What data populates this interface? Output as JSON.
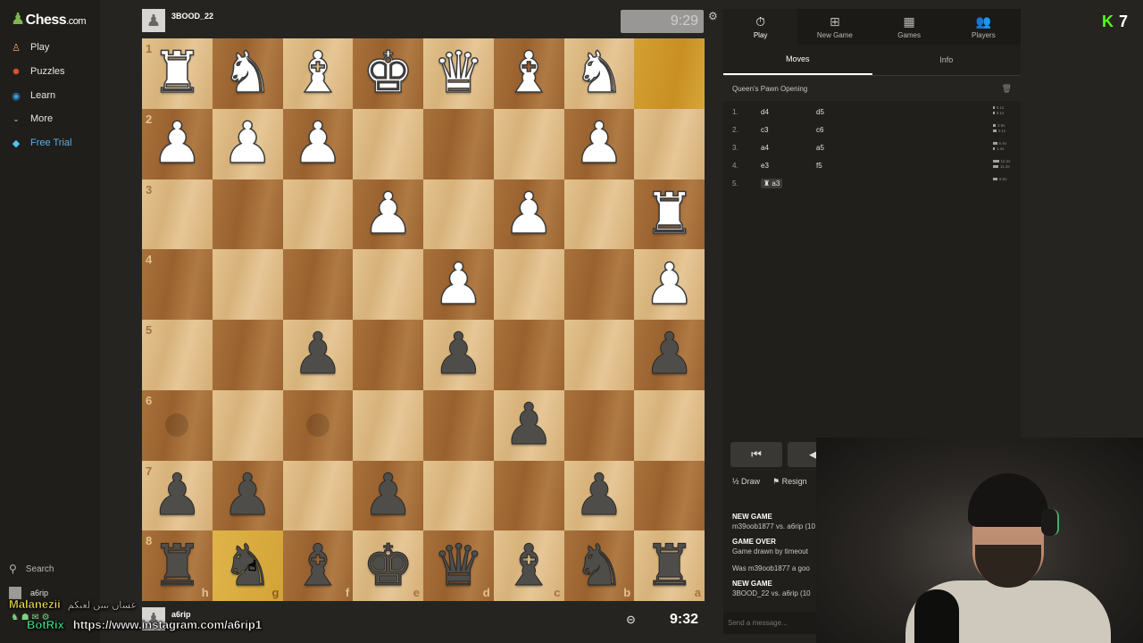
{
  "sidebar": {
    "logo_text": "Chess",
    "logo_suffix": ".com",
    "items": [
      {
        "label": "Play",
        "icon": "play-icon"
      },
      {
        "label": "Puzzles",
        "icon": "puzzle-icon"
      },
      {
        "label": "Learn",
        "icon": "learn-icon"
      },
      {
        "label": "More",
        "icon": "chevron-down-icon"
      },
      {
        "label": "Free Trial",
        "icon": "diamond-icon"
      }
    ],
    "search_label": "Search",
    "user_label": "a6rip"
  },
  "top_player": {
    "name": "3BOOD_22",
    "clock": "9:29"
  },
  "bottom_player": {
    "name": "a6rip",
    "clock": "9:32"
  },
  "board": {
    "ranks": [
      "1",
      "2",
      "3",
      "4",
      "5",
      "6",
      "7",
      "8"
    ],
    "files": [
      "h",
      "g",
      "f",
      "e",
      "d",
      "c",
      "b",
      "a"
    ],
    "rows": [
      [
        "wR",
        "wN",
        "wB",
        "wK",
        "wQ",
        "wB",
        "wN",
        ""
      ],
      [
        "wP",
        "wP",
        "wP",
        "",
        "",
        "",
        "wP",
        ""
      ],
      [
        "",
        "",
        "",
        "wP",
        "",
        "wP",
        "",
        "wR"
      ],
      [
        "",
        "",
        "",
        "",
        "wP",
        "",
        "",
        "wP"
      ],
      [
        "",
        "",
        "bP",
        "",
        "bP",
        "",
        "",
        "bP"
      ],
      [
        "",
        "",
        "",
        "",
        "",
        "bP",
        "",
        ""
      ],
      [
        "bP",
        "bP",
        "",
        "bP",
        "",
        "",
        "bP",
        ""
      ],
      [
        "bR",
        "bN",
        "bB",
        "bK",
        "bQ",
        "bB",
        "bN",
        "bR"
      ]
    ]
  },
  "panel": {
    "tabs": [
      {
        "label": "Play",
        "icon": "stopwatch-icon"
      },
      {
        "label": "New Game",
        "icon": "plus-icon"
      },
      {
        "label": "Games",
        "icon": "board-icon"
      },
      {
        "label": "Players",
        "icon": "players-icon"
      }
    ],
    "subtabs": [
      "Moves",
      "Info"
    ],
    "opening": "Queen's Pawn Opening",
    "moves": [
      {
        "num": "1.",
        "white": "d4",
        "black": "d5",
        "times": [
          "0.1s",
          "0.1s"
        ]
      },
      {
        "num": "2.",
        "white": "c3",
        "black": "c6",
        "times": [
          "3.8s",
          "4.1s"
        ]
      },
      {
        "num": "3.",
        "white": "a4",
        "black": "a5",
        "times": [
          "6.4s",
          "1.4s"
        ]
      },
      {
        "num": "4.",
        "white": "e3",
        "black": "f5",
        "times": [
          "12.2s",
          "11.3s"
        ]
      },
      {
        "num": "5.",
        "white": "♜ a3",
        "black": "",
        "times": [
          "8.6s"
        ]
      }
    ],
    "draw_label": "Draw",
    "resign_label": "Resign",
    "chat": [
      {
        "head": "NEW GAME",
        "text": "m39oob1877 vs. a6rip (10"
      },
      {
        "head": "GAME OVER",
        "text": "Game drawn by timeout"
      },
      {
        "head": "",
        "text": "Was m39oob1877 a goo"
      },
      {
        "head": "NEW GAME",
        "text": "3BOOD_22 vs. a6rip (10"
      }
    ],
    "message_placeholder": "Send a message..."
  },
  "overlay": {
    "kick_count": "7",
    "chat_user": "Malanezii",
    "chat_msg": "عشان يبين لعبكم",
    "bot_name": "BotRix",
    "bot_msg": "https://www.instagram.com/a6rip1"
  }
}
